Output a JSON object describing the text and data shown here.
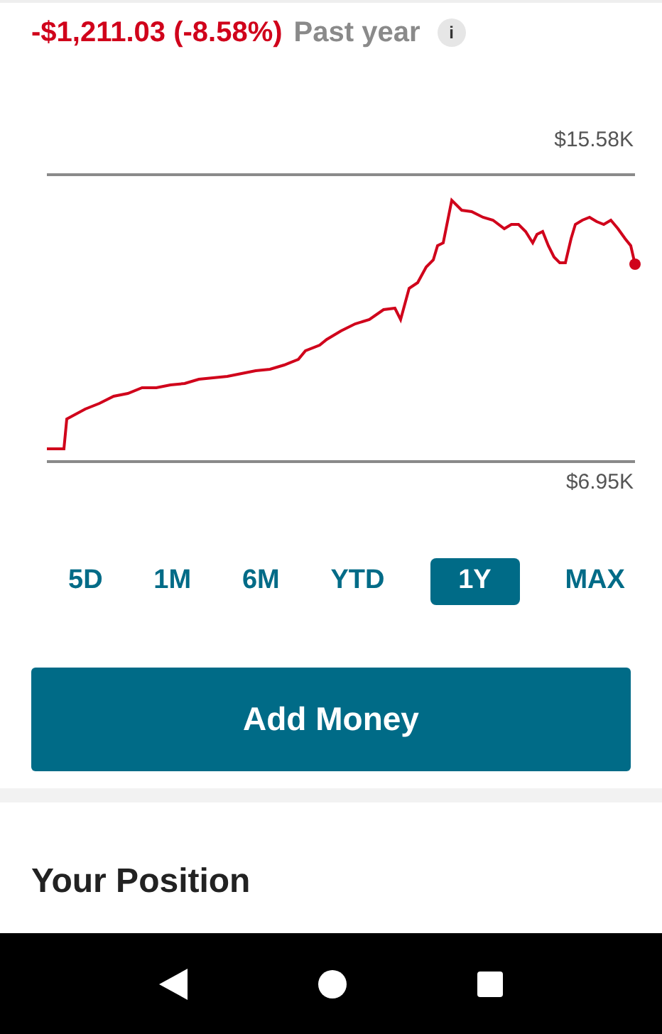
{
  "summary": {
    "change": "-$1,211.03 (-8.58%)",
    "period": "Past year",
    "info": "i"
  },
  "chart": {
    "high_label": "$15.58K",
    "low_label": "$6.95K"
  },
  "ranges": [
    {
      "label": "5D",
      "selected": false
    },
    {
      "label": "1M",
      "selected": false
    },
    {
      "label": "6M",
      "selected": false
    },
    {
      "label": "YTD",
      "selected": false
    },
    {
      "label": "1Y",
      "selected": true
    },
    {
      "label": "MAX",
      "selected": false
    }
  ],
  "primary_button": "Add Money",
  "section_title": "Your Position"
}
